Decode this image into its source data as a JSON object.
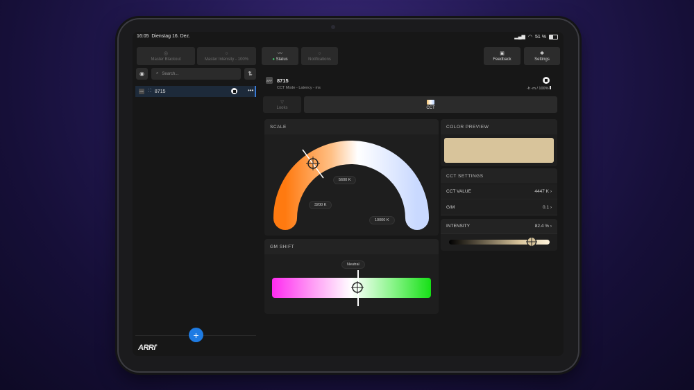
{
  "status_bar": {
    "time": "16:05",
    "date": "Dienstag 16. Dez.",
    "battery": "51 %"
  },
  "toolbar": {
    "master_blackout": "Master Blackout",
    "master_intensity": "Master Intensity - 100%",
    "status": "Status",
    "notifications": "Notifications",
    "feedback": "Feedback",
    "settings": "Settings"
  },
  "sidebar": {
    "search_placeholder": "Search...",
    "device": {
      "badge": "APP",
      "name": "8715"
    }
  },
  "device_header": {
    "badge": "APP",
    "name": "8715",
    "subtitle": "CCT Mode - Latency - ms",
    "status": "-h -m / 100%"
  },
  "mode_tabs": {
    "looks": "Looks",
    "cct": "CCT"
  },
  "scale": {
    "title": "SCALE",
    "label_5600": "5600 K",
    "label_3200": "3200 K",
    "label_10000": "10000 K"
  },
  "gm_shift": {
    "title": "GM SHIFT",
    "neutral": "Neutral"
  },
  "color_preview": {
    "title": "COLOR PREVIEW",
    "color": "#d8c49b"
  },
  "cct_settings": {
    "title": "CCT SETTINGS",
    "cct_value_label": "CCT VALUE",
    "cct_value": "4447 K",
    "gm_label": "G/M",
    "gm_value": "0.1",
    "intensity_label": "INTENSITY",
    "intensity_value": "82.4 %",
    "intensity_level": 0.824
  },
  "brand": "ARRI"
}
